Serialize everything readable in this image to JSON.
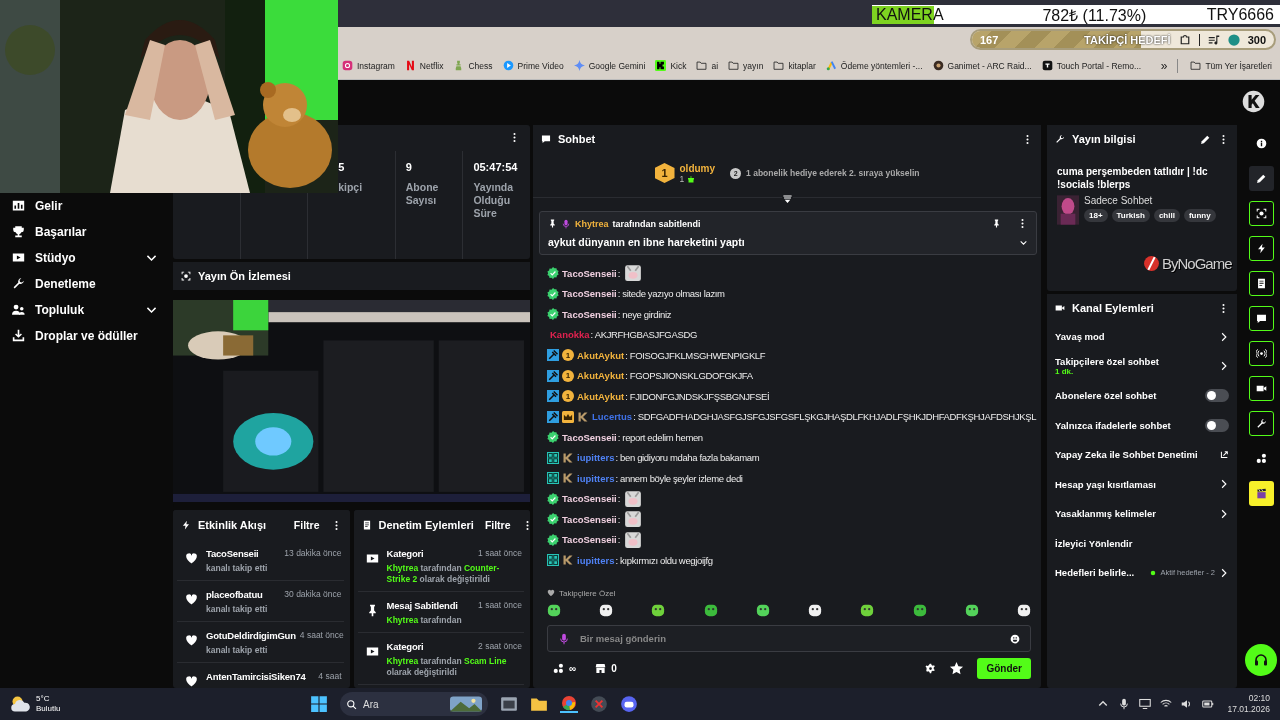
{
  "overlay": {
    "ticker": {
      "label": "KAMERA",
      "price": "782₺ (11.73%)",
      "goal": "TRY6666"
    },
    "follower_goal": {
      "current": "167",
      "title": "TAKİPÇİ HEDEFİ",
      "target": "300",
      "level": 0.56
    }
  },
  "bookmarks": [
    {
      "label": "Instagram",
      "kind": "instagram"
    },
    {
      "label": "Netflix",
      "kind": "netflix"
    },
    {
      "label": "Chess",
      "kind": "chess"
    },
    {
      "label": "Prime Video",
      "kind": "prime"
    },
    {
      "label": "Google Gemini",
      "kind": "gemini"
    },
    {
      "label": "Kick",
      "kind": "kick"
    },
    {
      "label": "ai",
      "kind": "folder"
    },
    {
      "label": "yayın",
      "kind": "folder"
    },
    {
      "label": "kitaplar",
      "kind": "folder"
    },
    {
      "label": "Ödeme yöntemleri -...",
      "kind": "ads"
    },
    {
      "label": "Ganimet - ARC Raid...",
      "kind": "game"
    },
    {
      "label": "Touch Portal - Remo...",
      "kind": "touch"
    }
  ],
  "bookmarks_more": "»",
  "all_bookmarks": "Tüm Yer İşaretleri",
  "sidebar": {
    "items": [
      {
        "label": "Gelir",
        "kind": "income",
        "expandable": false
      },
      {
        "label": "Başarılar",
        "kind": "trophy",
        "expandable": false
      },
      {
        "label": "Stüdyo",
        "kind": "studio",
        "expandable": true
      },
      {
        "label": "Denetleme",
        "kind": "wrench",
        "expandable": false
      },
      {
        "label": "Topluluk",
        "kind": "community",
        "expandable": true
      },
      {
        "label": "Droplar ve ödüller",
        "kind": "drops",
        "expandable": false
      }
    ]
  },
  "stats": [
    {
      "value": "5",
      "label": "kipçi"
    },
    {
      "value": "9",
      "label": "Abone Sayısı"
    },
    {
      "value": "05:47:54",
      "label": "Yayında Olduğu Süre"
    }
  ],
  "preview": {
    "title": "Yayın Ön İzlemesi",
    "kind": "picture"
  },
  "activity": {
    "title": "Etkinlik Akışı",
    "filter": "Filtre",
    "items": [
      {
        "user": "TacoSenseii",
        "time": "13 dakika önce",
        "action": "kanalı takip etti"
      },
      {
        "user": "placeofbatuu",
        "time": "30 dakika önce",
        "action": "kanalı takip etti"
      },
      {
        "user": "GotuDeldirdigimGun",
        "time": "4 saat önce",
        "action": "kanalı takip etti"
      },
      {
        "user": "AntenTamircisiSiken74",
        "time": "4 saat"
      }
    ]
  },
  "moderation": {
    "title": "Denetim Eylemleri",
    "filter": "Filtre",
    "items": [
      {
        "kind": "category",
        "title": "Kategori",
        "time": "1 saat önce",
        "detail": "**Khytrea** tarafından **Counter-Strike 2** olarak değiştirildi"
      },
      {
        "kind": "pin",
        "title": "Mesaj Sabitlendi",
        "time": "1 saat önce",
        "detail": "**Khytrea** tarafından"
      },
      {
        "kind": "category",
        "title": "Kategori",
        "time": "2 saat önce",
        "detail": "**Khytrea** tarafından **Scam Line** olarak değiştirildi"
      }
    ]
  },
  "chat": {
    "title": "Sohbet",
    "top_gifter": {
      "rank": "1",
      "user": "oldumy",
      "count": "1",
      "next_rank": "2",
      "hint": "1 abonelik hediye ederek 2. sıraya yükselin"
    },
    "pinned": {
      "user": "Khytrea",
      "by": "tarafından sabitlendi",
      "message": "aykut dünyanın en ibne hareketini yaptı"
    },
    "messages": [
      {
        "user": "TacoSenseii",
        "color": "#f0d0e0",
        "badges": [
          {
            "kind": "verified"
          }
        ],
        "kind": "emote",
        "text": ":"
      },
      {
        "user": "TacoSenseii",
        "color": "#f0d0e0",
        "badges": [
          {
            "kind": "verified"
          }
        ],
        "kind": "text",
        "text": ": sitede yazıyo olması lazım"
      },
      {
        "user": "TacoSenseii",
        "color": "#f0d0e0",
        "badges": [
          {
            "kind": "verified"
          }
        ],
        "kind": "text",
        "text": ": neye girdiniz"
      },
      {
        "user": "Kanokka",
        "color": "#e0224f",
        "kind": "text",
        "text": ": AKJRFHGBASJFGASDG"
      },
      {
        "user": "AkutAykut",
        "color": "#f2b33d",
        "badges": [
          {
            "kind": "moderator"
          },
          {
            "kind": "subscriber",
            "label": "1"
          }
        ],
        "kind": "text",
        "text": ": FOISOGJFKLMSGHWENPIGKLF"
      },
      {
        "user": "AkutAykut",
        "color": "#f2b33d",
        "badges": [
          {
            "kind": "moderator"
          },
          {
            "kind": "subscriber",
            "label": "1"
          }
        ],
        "kind": "text",
        "text": ": FGOPSJIONSKLGDOFGKJFA"
      },
      {
        "user": "AkutAykut",
        "color": "#f2b33d",
        "badges": [
          {
            "kind": "moderator"
          },
          {
            "kind": "subscriber",
            "label": "1"
          }
        ],
        "kind": "text",
        "text": ": FJIDONFGJNDSKJFŞSBGNJFSEİ"
      },
      {
        "user": "Lucertus",
        "color": "#3f72e8",
        "badges": [
          {
            "kind": "moderator"
          },
          {
            "kind": "founder"
          },
          {
            "kind": "kick"
          }
        ],
        "kind": "text",
        "text": ": SDFGADFHADGHJASFGJSFGJSFGSFLŞKGJHAŞDLFKHJADLFŞHKJDHFADFKŞHJAFDSHJKŞL"
      },
      {
        "user": "TacoSenseii",
        "color": "#f0d0e0",
        "badges": [
          {
            "kind": "verified"
          }
        ],
        "kind": "text",
        "text": ": report edelim hemen"
      },
      {
        "user": "iupitters",
        "color": "#4f82f5",
        "badges": [
          {
            "kind": "og"
          },
          {
            "kind": "kick"
          }
        ],
        "kind": "text",
        "text": ": ben gidiyoru mdaha fazla bakamam"
      },
      {
        "user": "iupitters",
        "color": "#4f82f5",
        "badges": [
          {
            "kind": "og"
          },
          {
            "kind": "kick"
          }
        ],
        "kind": "text",
        "text": ": annem böyle şeyler izleme dedi"
      },
      {
        "user": "TacoSenseii",
        "color": "#f0d0e0",
        "badges": [
          {
            "kind": "verified"
          }
        ],
        "kind": "emote",
        "text": ":"
      },
      {
        "user": "TacoSenseii",
        "color": "#f0d0e0",
        "badges": [
          {
            "kind": "verified"
          }
        ],
        "kind": "emote",
        "text": ":"
      },
      {
        "user": "TacoSenseii",
        "color": "#f0d0e0",
        "badges": [
          {
            "kind": "verified"
          }
        ],
        "kind": "emote",
        "text": ":"
      },
      {
        "user": "iupitters",
        "color": "#4f82f5",
        "badges": [
          {
            "kind": "og"
          },
          {
            "kind": "kick"
          }
        ],
        "kind": "text",
        "text": ": kıpkırmızı oldu wegjoijfg"
      }
    ],
    "emote_section": "Takipçilere Özel",
    "input": {
      "placeholder": "Bir mesaj gönderin"
    },
    "points": "∞",
    "store_count": "0",
    "send": "Gönder"
  },
  "stream_info": {
    "title": "Yayın bilgisi",
    "stream_title": "cuma perşembeden tatlıdır | !dc !socials !blerps",
    "category": "Sadece Sohbet",
    "tags": [
      "18+",
      "Turkish",
      "chill",
      "funny"
    ],
    "logo_text": "ByNoGame"
  },
  "channel_actions": {
    "title": "Kanal Eylemleri",
    "items": [
      {
        "label": "Yavaş mod",
        "kind": "link"
      },
      {
        "label": "Takipçilere özel sohbet",
        "sub": "1 dk.",
        "kind": "link"
      },
      {
        "label": "Abonelere özel sohbet",
        "kind": "toggle",
        "on": false
      },
      {
        "label": "Yalnızca ifadelerle sohbet",
        "kind": "toggle",
        "on": false
      },
      {
        "label": "Yapay Zeka ile Sohbet Denetimi",
        "kind": "external"
      },
      {
        "label": "Hesap yaşı kısıtlaması",
        "kind": "link"
      },
      {
        "label": "Yasaklanmış kelimeler",
        "kind": "link"
      },
      {
        "label": "İzleyici Yönlendir",
        "kind": "plain"
      },
      {
        "label": "Hedefleri belirle...",
        "status": "Aktif hedefler - 2",
        "kind": "link"
      }
    ]
  },
  "rail": [
    {
      "kind": "info"
    },
    {
      "kind": "pencil"
    },
    {
      "kind": "preview"
    },
    {
      "kind": "bolt"
    },
    {
      "kind": "doc"
    },
    {
      "kind": "chat"
    },
    {
      "kind": "broadcast"
    },
    {
      "kind": "video"
    },
    {
      "kind": "wrench"
    },
    {
      "kind": "dots"
    },
    {
      "kind": "clapper"
    }
  ],
  "taskbar": {
    "temperature": "5°C",
    "condition": "Bulutlu",
    "search_placeholder": "Ara",
    "time": "02:10",
    "date": "17.01.2026"
  }
}
